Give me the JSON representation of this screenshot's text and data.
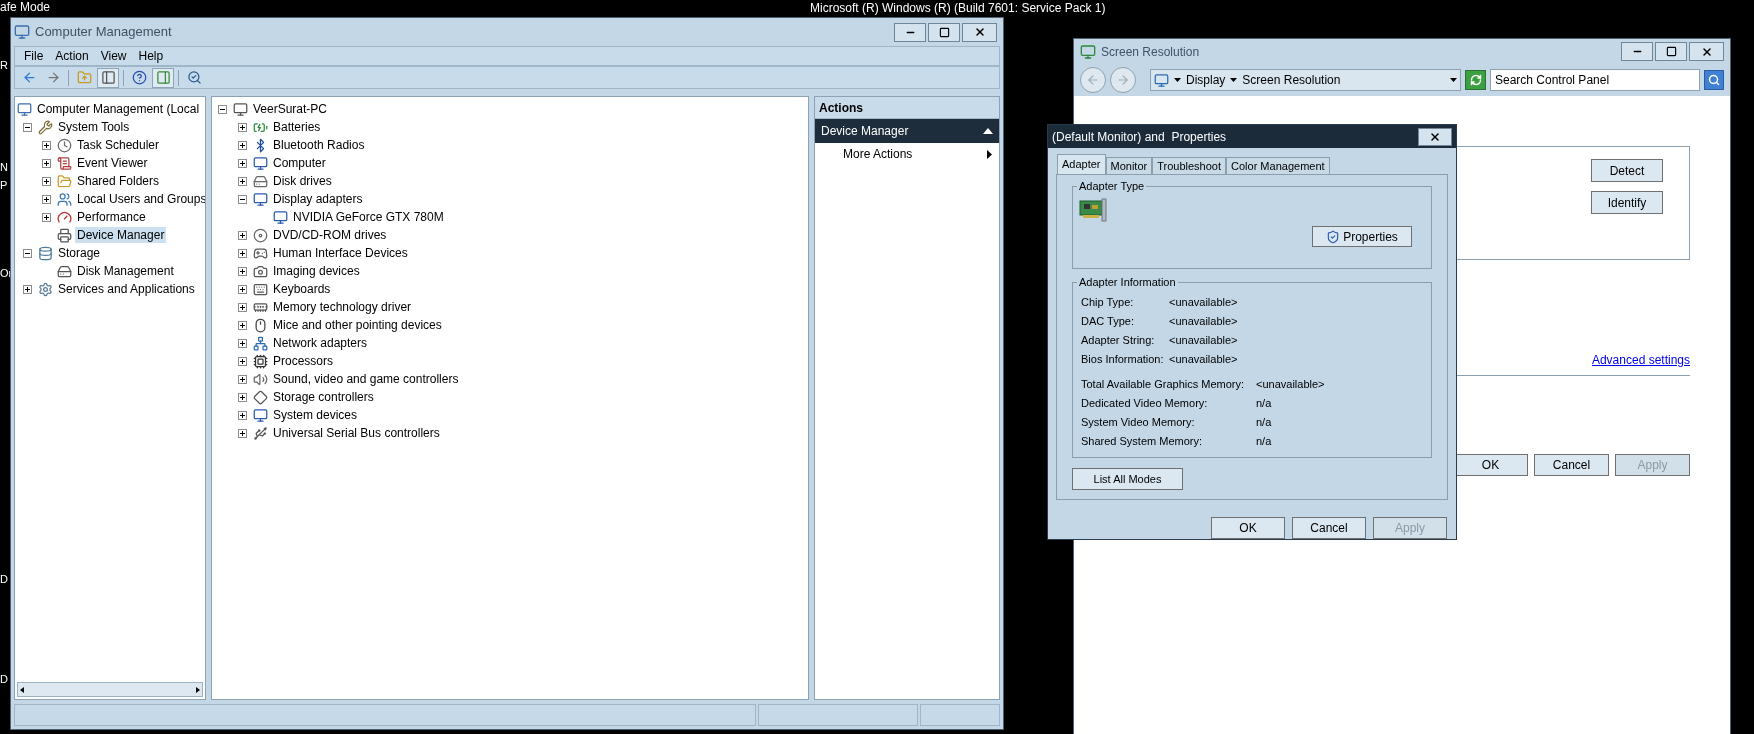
{
  "desktop": {
    "corner_label": "afe Mode",
    "edge_labels": [
      "R",
      "N",
      "P",
      "Or",
      "D",
      "D"
    ],
    "build_info": "Microsoft (R) Windows (R) (Build 7601: Service Pack 1)"
  },
  "computer_management": {
    "title": "Computer Management",
    "menu": [
      "File",
      "Action",
      "View",
      "Help"
    ],
    "toolbar": [
      {
        "on": false
      },
      {
        "on": false
      },
      {
        "on": false
      },
      {
        "on": true
      },
      {
        "on": false
      },
      {
        "on": true
      },
      {
        "on": false
      }
    ],
    "left_tree": [
      {
        "label": "Computer Management (Local",
        "selected": false,
        "children": [
          {
            "label": "System Tools",
            "expanded": true,
            "selected": false,
            "children": [
              {
                "label": "Task Scheduler",
                "expanded": false,
                "selected": false
              },
              {
                "label": "Event Viewer",
                "expanded": false,
                "selected": false
              },
              {
                "label": "Shared Folders",
                "expanded": false,
                "selected": false
              },
              {
                "label": "Local Users and Groups",
                "expanded": false,
                "selected": false
              },
              {
                "label": "Performance",
                "expanded": false,
                "selected": false
              },
              {
                "label": "Device Manager",
                "selected": true
              }
            ]
          },
          {
            "label": "Storage",
            "expanded": true,
            "selected": false,
            "children": [
              {
                "label": "Disk Management",
                "selected": false
              }
            ]
          },
          {
            "label": "Services and Applications",
            "expanded": false,
            "selected": false
          }
        ]
      }
    ],
    "device_tree": [
      {
        "label": "VeerSurat-PC",
        "expanded": true,
        "children": [
          {
            "label": "Batteries",
            "expanded": false
          },
          {
            "label": "Bluetooth Radios",
            "expanded": false
          },
          {
            "label": "Computer",
            "expanded": false
          },
          {
            "label": "Disk drives",
            "expanded": false
          },
          {
            "label": "Display adapters",
            "expanded": true,
            "children": [
              {
                "label": "NVIDIA GeForce GTX 780M"
              }
            ]
          },
          {
            "label": "DVD/CD-ROM drives",
            "expanded": false
          },
          {
            "label": "Human Interface Devices",
            "expanded": false
          },
          {
            "label": "Imaging devices",
            "expanded": false
          },
          {
            "label": "Keyboards",
            "expanded": false
          },
          {
            "label": "Memory technology driver",
            "expanded": false
          },
          {
            "label": "Mice and other pointing devices",
            "expanded": false
          },
          {
            "label": "Network adapters",
            "expanded": false
          },
          {
            "label": "Processors",
            "expanded": false
          },
          {
            "label": "Sound, video and game controllers",
            "expanded": false
          },
          {
            "label": "Storage controllers",
            "expanded": false
          },
          {
            "label": "System devices",
            "expanded": false
          },
          {
            "label": "Universal Serial Bus controllers",
            "expanded": false
          }
        ]
      }
    ],
    "actions": {
      "header": "Actions",
      "section": {
        "title": "Device Manager",
        "expanded": true
      },
      "items": [
        "More Actions"
      ]
    }
  },
  "screen_resolution": {
    "title": "Screen Resolution",
    "breadcrumb": [
      "Display",
      "Screen Resolution"
    ],
    "search": {
      "placeholder": "Search Control Panel"
    },
    "side_buttons": [
      "Detect",
      "Identify"
    ],
    "link": "Advanced settings",
    "buttons": [
      {
        "label": "OK",
        "disabled": false
      },
      {
        "label": "Cancel",
        "disabled": false
      },
      {
        "label": "Apply",
        "disabled": true
      }
    ]
  },
  "dialog": {
    "title": "(Default Monitor) and  Properties",
    "tabs": [
      {
        "label": "Adapter",
        "selected": true
      },
      {
        "label": "Monitor",
        "selected": false
      },
      {
        "label": "Troubleshoot",
        "selected": false
      },
      {
        "label": "Color Management",
        "selected": false
      }
    ],
    "adapter_type": {
      "heading": "Adapter Type",
      "button": "Properties"
    },
    "adapter_information": {
      "heading": "Adapter Information",
      "rows": [
        {
          "label": "Chip Type:",
          "value": "<unavailable>"
        },
        {
          "label": "DAC Type:",
          "value": "<unavailable>"
        },
        {
          "label": "Adapter String:",
          "value": "<unavailable>"
        },
        {
          "label": "Bios Information:",
          "value": "<unavailable>"
        }
      ],
      "memory_rows": [
        {
          "label": "Total Available Graphics Memory:",
          "value": "<unavailable>"
        },
        {
          "label": "Dedicated Video Memory:",
          "value": "n/a"
        },
        {
          "label": "System Video Memory:",
          "value": "n/a"
        },
        {
          "label": "Shared System Memory:",
          "value": "n/a"
        }
      ]
    },
    "list_button": "List All Modes",
    "buttons": [
      {
        "label": "OK",
        "disabled": false
      },
      {
        "label": "Cancel",
        "disabled": false
      },
      {
        "label": "Apply",
        "disabled": true
      }
    ]
  }
}
